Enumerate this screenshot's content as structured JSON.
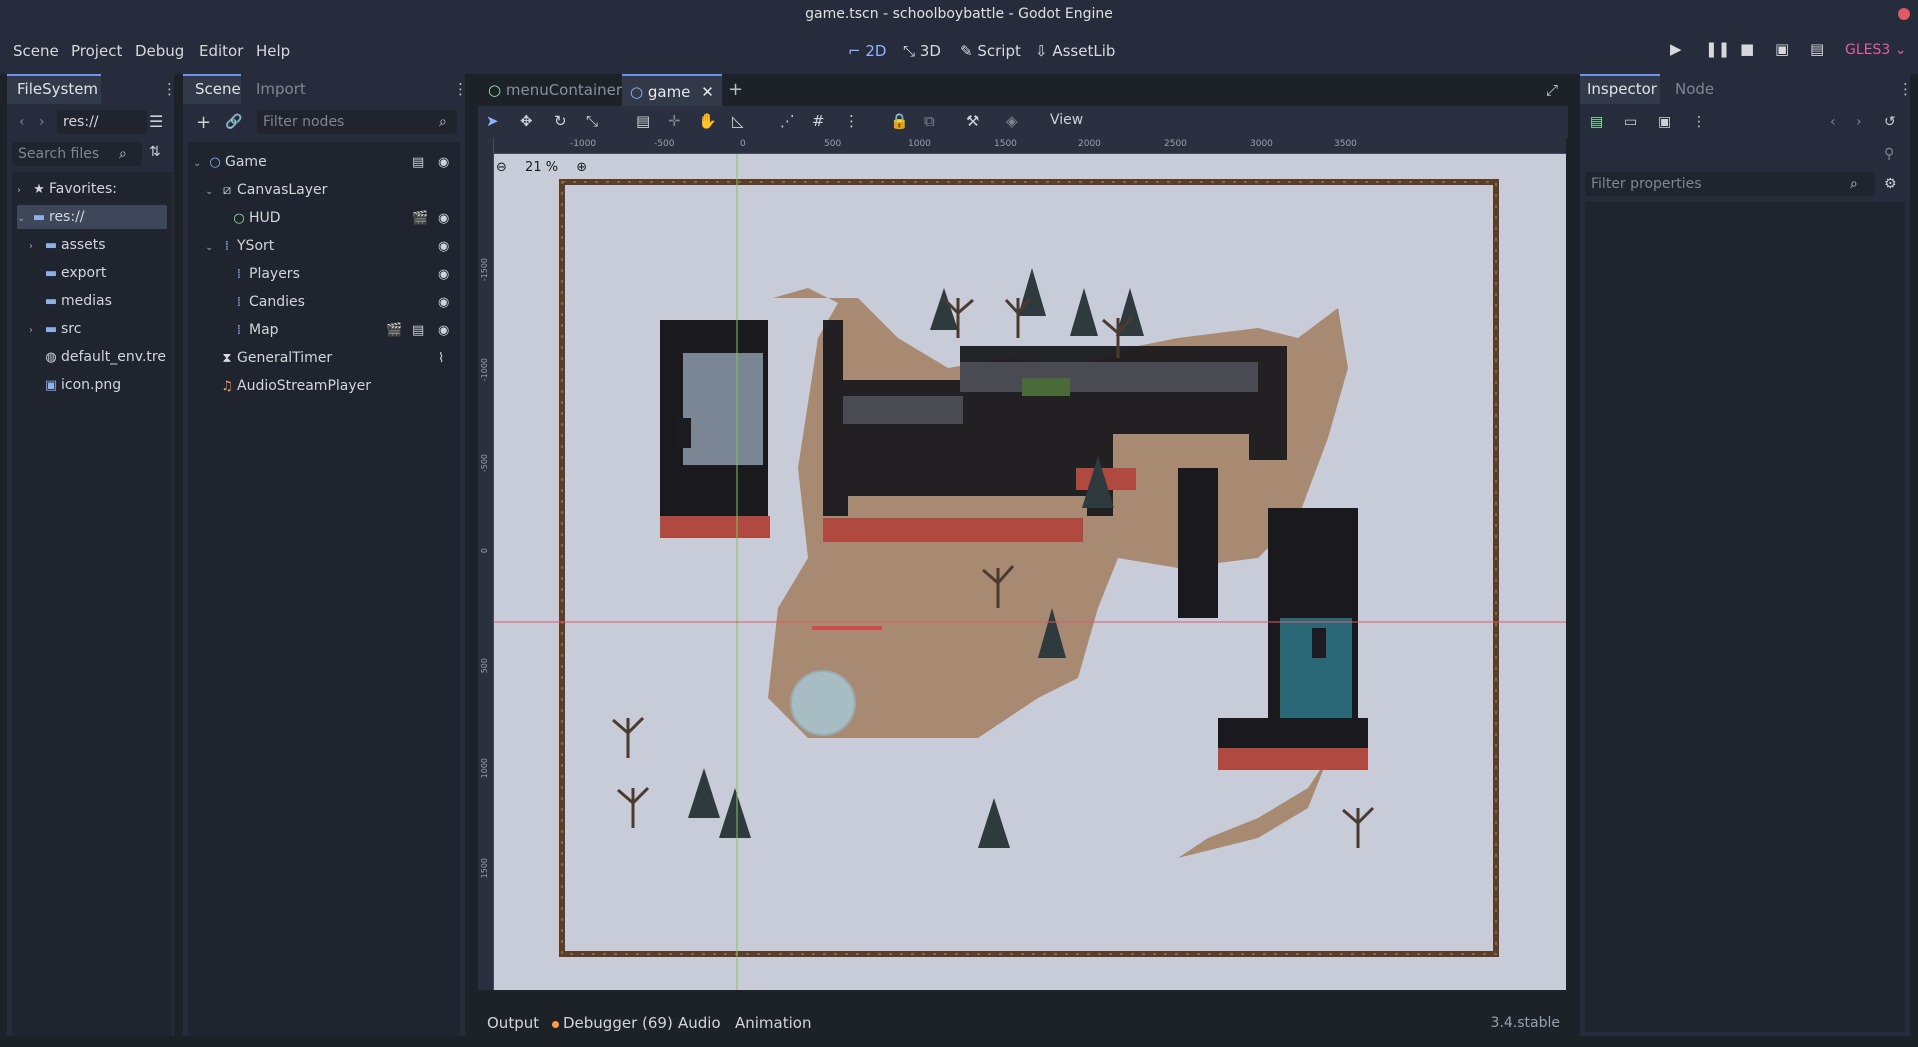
{
  "window": {
    "title": "game.tscn - schoolboybattle - Godot Engine"
  },
  "menu": [
    "Scene",
    "Project",
    "Debug",
    "Editor",
    "Help"
  ],
  "modes": {
    "m2d": "2D",
    "m3d": "3D",
    "script": "Script",
    "assetlib": "AssetLib"
  },
  "renderer": "GLES3",
  "filesystem": {
    "tab": "FileSystem",
    "path": "res://",
    "search_placeholder": "Search files",
    "items": [
      {
        "label": "Favorites:",
        "icon": "star-icon"
      },
      {
        "label": "res://",
        "icon": "folder-icon"
      },
      {
        "label": "assets",
        "icon": "folder-icon"
      },
      {
        "label": "export",
        "icon": "folder-icon"
      },
      {
        "label": "medias",
        "icon": "folder-icon"
      },
      {
        "label": "src",
        "icon": "folder-icon"
      },
      {
        "label": "default_env.tre",
        "icon": "globe-icon"
      },
      {
        "label": "icon.png",
        "icon": "image-icon"
      }
    ]
  },
  "scene": {
    "tabs": [
      "Scene",
      "Import"
    ],
    "filter_placeholder": "Filter nodes",
    "nodes": [
      {
        "label": "Game",
        "icon": "node2d-icon"
      },
      {
        "label": "CanvasLayer",
        "icon": "canvaslayer-icon"
      },
      {
        "label": "HUD",
        "icon": "control-icon"
      },
      {
        "label": "YSort",
        "icon": "ysort-icon"
      },
      {
        "label": "Players",
        "icon": "ysort-icon"
      },
      {
        "label": "Candies",
        "icon": "ysort-icon"
      },
      {
        "label": "Map",
        "icon": "ysort-icon"
      },
      {
        "label": "GeneralTimer",
        "icon": "timer-icon"
      },
      {
        "label": "AudioStreamPlayer",
        "icon": "audio-icon"
      }
    ]
  },
  "editor_tabs": [
    "menuContainer",
    "game"
  ],
  "viewport": {
    "zoom": "21 %",
    "view_menu": "View",
    "ruler_x": [
      "-1000",
      "-500",
      "0",
      "500",
      "1000",
      "1500",
      "2000",
      "2500",
      "3000",
      "3500"
    ],
    "ruler_y": [
      "-1500",
      "-1000",
      "-500",
      "0",
      "500",
      "1000",
      "1500"
    ]
  },
  "inspector": {
    "tabs": [
      "Inspector",
      "Node"
    ],
    "filter_placeholder": "Filter properties"
  },
  "bottom": {
    "tabs": [
      "Output",
      "Debugger (69)",
      "Audio",
      "Animation"
    ],
    "version": "3.4.stable"
  }
}
